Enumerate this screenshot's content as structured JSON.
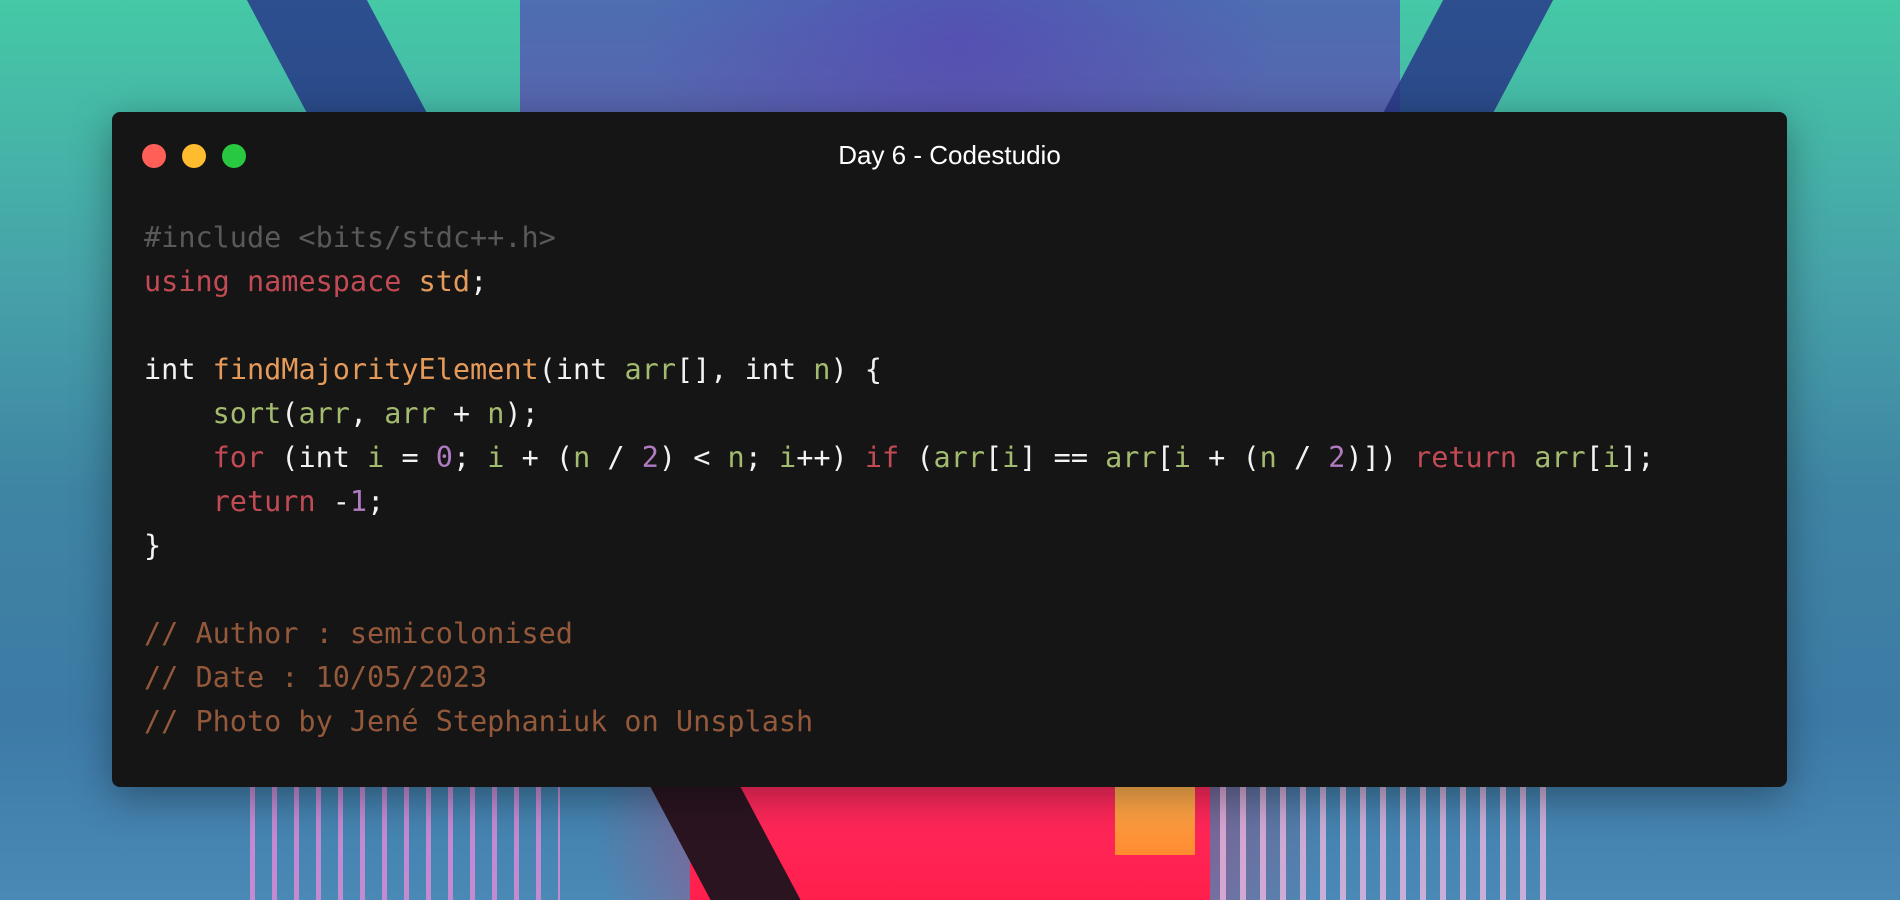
{
  "window": {
    "title": "Day 6 - Codestudio",
    "controls": [
      "close",
      "minimize",
      "maximize"
    ]
  },
  "colors": {
    "window_bg": "#151515",
    "close": "#ff5f57",
    "minimize": "#febc2e",
    "maximize": "#28c840",
    "preprocessor": "#595959",
    "keyword": "#c24a54",
    "identifier": "#e59a5a",
    "plain": "#f2f2f2",
    "variable": "#a3bb6e",
    "number": "#b17bc2",
    "comment": "#94593b"
  },
  "code_lines": [
    [
      {
        "t": "#include <bits/stdc++.h>",
        "c": "preproc"
      }
    ],
    [
      {
        "t": "using",
        "c": "keyword"
      },
      {
        "t": " ",
        "c": "plain"
      },
      {
        "t": "namespace",
        "c": "keyword"
      },
      {
        "t": " ",
        "c": "plain"
      },
      {
        "t": "std",
        "c": "ident"
      },
      {
        "t": ";",
        "c": "plain"
      }
    ],
    [],
    [
      {
        "t": "int",
        "c": "type"
      },
      {
        "t": " ",
        "c": "plain"
      },
      {
        "t": "findMajorityElement",
        "c": "func"
      },
      {
        "t": "(",
        "c": "plain"
      },
      {
        "t": "int",
        "c": "type"
      },
      {
        "t": " ",
        "c": "plain"
      },
      {
        "t": "arr",
        "c": "var"
      },
      {
        "t": "[], ",
        "c": "plain"
      },
      {
        "t": "int",
        "c": "type"
      },
      {
        "t": " ",
        "c": "plain"
      },
      {
        "t": "n",
        "c": "var"
      },
      {
        "t": ") {",
        "c": "plain"
      }
    ],
    [
      {
        "t": "    ",
        "c": "plain"
      },
      {
        "t": "sort",
        "c": "var"
      },
      {
        "t": "(",
        "c": "plain"
      },
      {
        "t": "arr",
        "c": "var"
      },
      {
        "t": ", ",
        "c": "plain"
      },
      {
        "t": "arr",
        "c": "var"
      },
      {
        "t": " + ",
        "c": "plain"
      },
      {
        "t": "n",
        "c": "var"
      },
      {
        "t": ");",
        "c": "plain"
      }
    ],
    [
      {
        "t": "    ",
        "c": "plain"
      },
      {
        "t": "for",
        "c": "keyword"
      },
      {
        "t": " (",
        "c": "plain"
      },
      {
        "t": "int",
        "c": "type"
      },
      {
        "t": " ",
        "c": "plain"
      },
      {
        "t": "i",
        "c": "var"
      },
      {
        "t": " = ",
        "c": "plain"
      },
      {
        "t": "0",
        "c": "num"
      },
      {
        "t": "; ",
        "c": "plain"
      },
      {
        "t": "i",
        "c": "var"
      },
      {
        "t": " + (",
        "c": "plain"
      },
      {
        "t": "n",
        "c": "var"
      },
      {
        "t": " / ",
        "c": "plain"
      },
      {
        "t": "2",
        "c": "num"
      },
      {
        "t": ") < ",
        "c": "plain"
      },
      {
        "t": "n",
        "c": "var"
      },
      {
        "t": "; ",
        "c": "plain"
      },
      {
        "t": "i",
        "c": "var"
      },
      {
        "t": "++) ",
        "c": "plain"
      },
      {
        "t": "if",
        "c": "keyword"
      },
      {
        "t": " (",
        "c": "plain"
      },
      {
        "t": "arr",
        "c": "var"
      },
      {
        "t": "[",
        "c": "plain"
      },
      {
        "t": "i",
        "c": "var"
      },
      {
        "t": "] == ",
        "c": "plain"
      },
      {
        "t": "arr",
        "c": "var"
      },
      {
        "t": "[",
        "c": "plain"
      },
      {
        "t": "i",
        "c": "var"
      },
      {
        "t": " + (",
        "c": "plain"
      },
      {
        "t": "n",
        "c": "var"
      },
      {
        "t": " / ",
        "c": "plain"
      },
      {
        "t": "2",
        "c": "num"
      },
      {
        "t": ")]) ",
        "c": "plain"
      },
      {
        "t": "return",
        "c": "keyword"
      },
      {
        "t": " ",
        "c": "plain"
      },
      {
        "t": "arr",
        "c": "var"
      },
      {
        "t": "[",
        "c": "plain"
      },
      {
        "t": "i",
        "c": "var"
      },
      {
        "t": "];",
        "c": "plain"
      }
    ],
    [
      {
        "t": "    ",
        "c": "plain"
      },
      {
        "t": "return",
        "c": "keyword"
      },
      {
        "t": " -",
        "c": "plain"
      },
      {
        "t": "1",
        "c": "num"
      },
      {
        "t": ";",
        "c": "plain"
      }
    ],
    [
      {
        "t": "}",
        "c": "plain"
      }
    ],
    [],
    [
      {
        "t": "// Author : semicolonised",
        "c": "comment"
      }
    ],
    [
      {
        "t": "// Date : 10/05/2023",
        "c": "comment"
      }
    ],
    [
      {
        "t": "// Photo by Jené Stephaniuk on Unsplash",
        "c": "comment"
      }
    ]
  ]
}
